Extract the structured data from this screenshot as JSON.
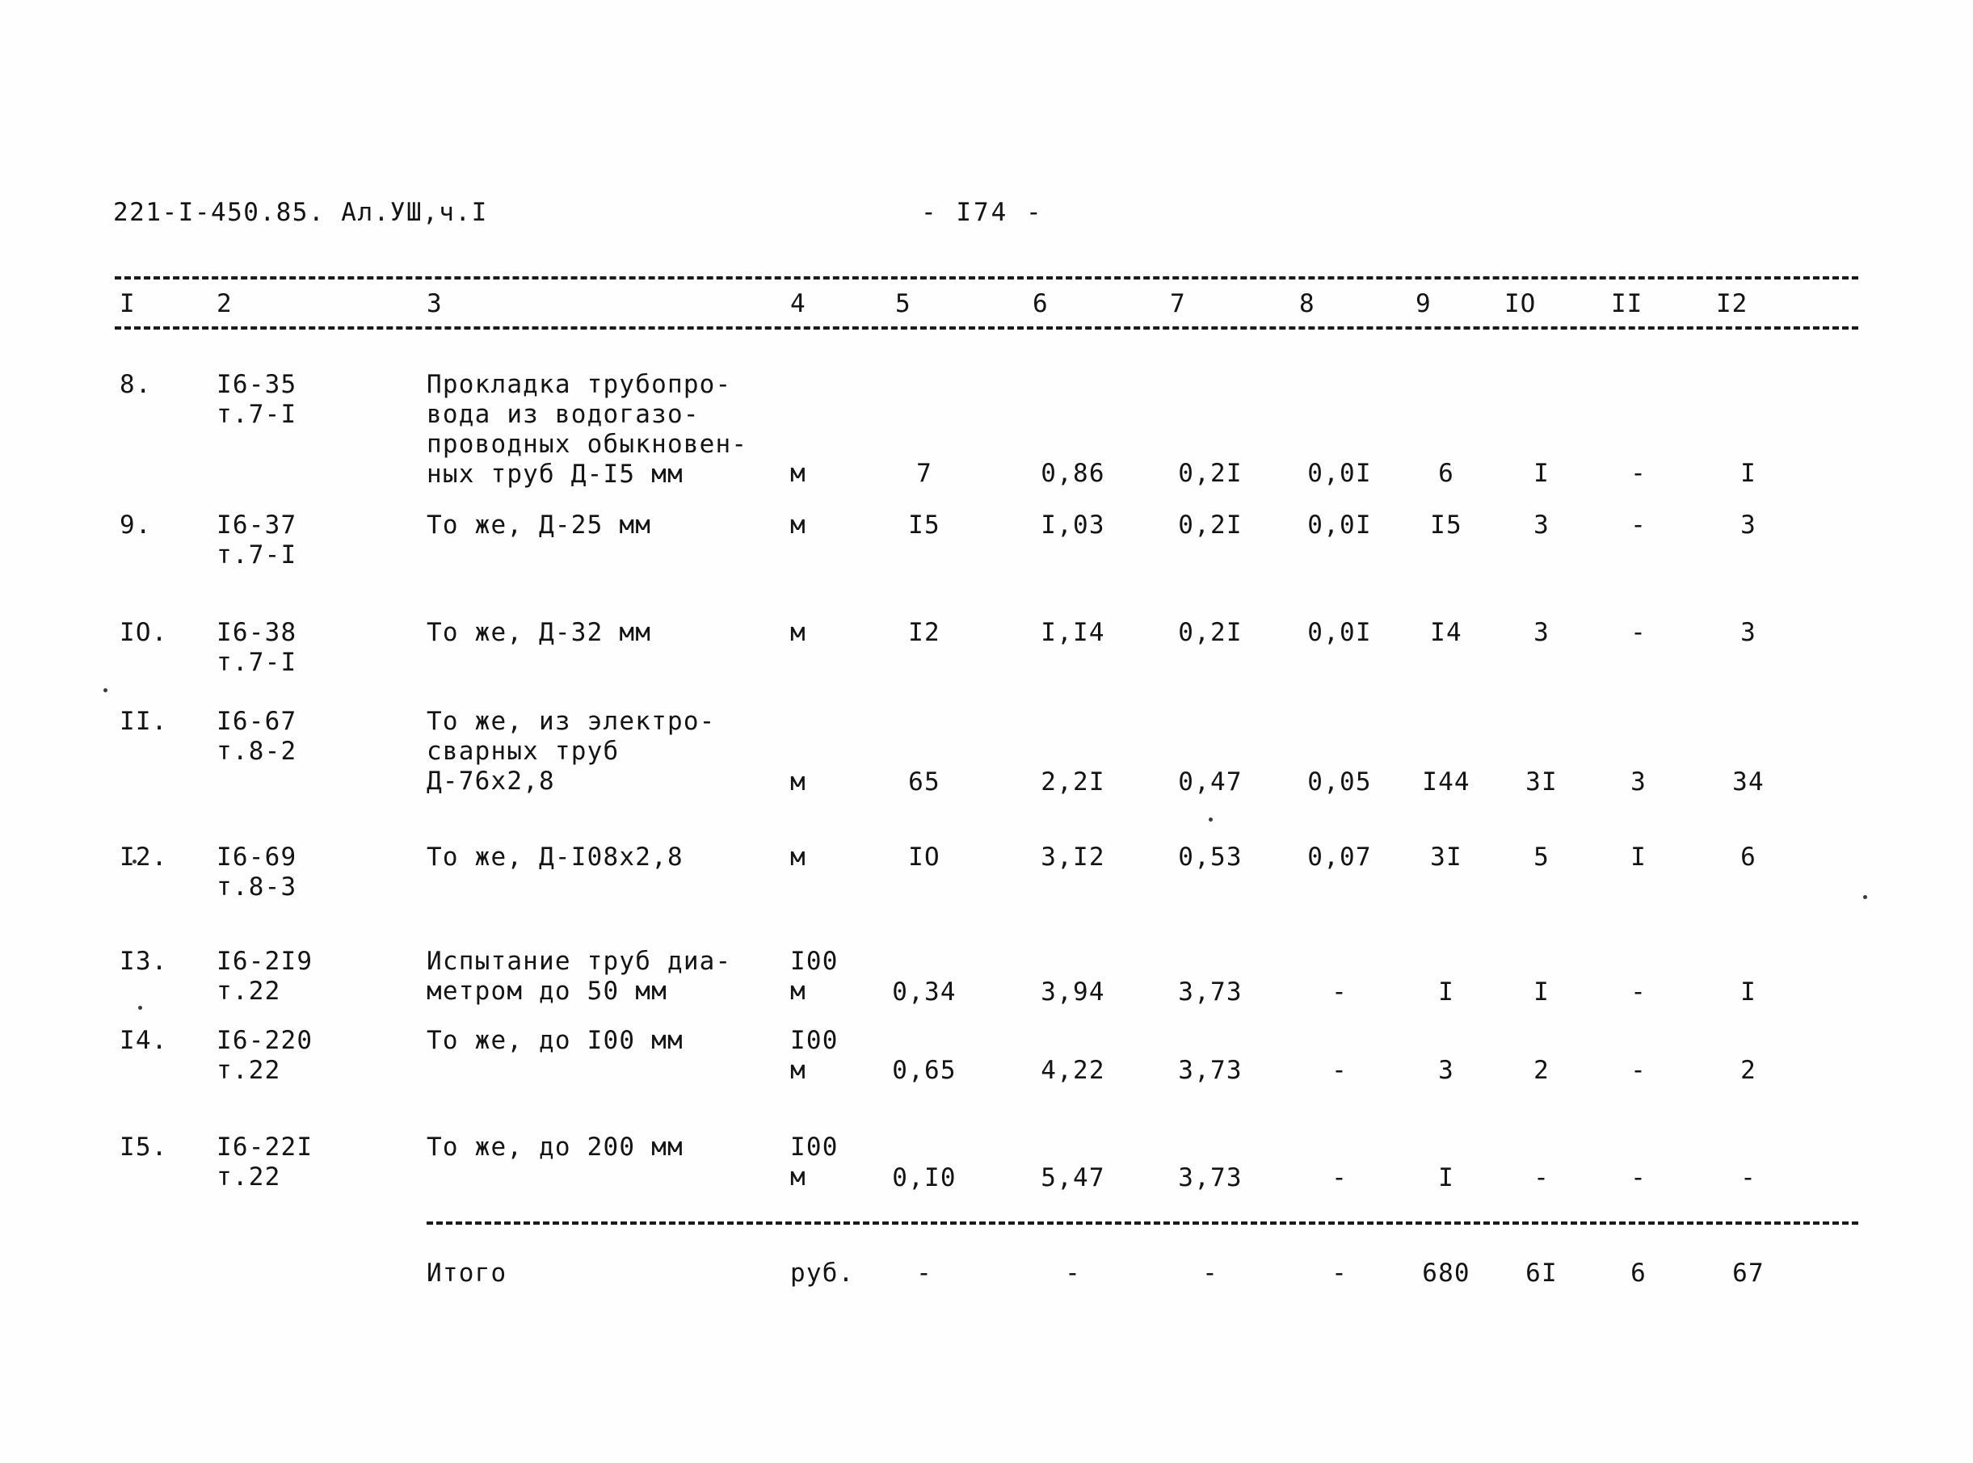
{
  "header": {
    "doc_code": "221-I-450.85. Ал.УШ,ч.I",
    "page_number": "-  I74  -"
  },
  "table": {
    "column_headers": [
      "I",
      "2",
      "3",
      "4",
      "5",
      "6",
      "7",
      "8",
      "9",
      "IO",
      "II",
      "I2"
    ],
    "rows": [
      {
        "num": "8.",
        "code": "I6-35\nт.7-I",
        "desc": "Прокладка трубопро-\nвода из водогазо-\nпроводных обыкновен-\nных труб Д-I5 мм",
        "unit": "м",
        "c5": "7",
        "c6": "0,86",
        "c7": "0,2I",
        "c8": "0,0I",
        "c9": "6",
        "c10": "I",
        "c11": "-",
        "c12": "I"
      },
      {
        "num": "9.",
        "code": "I6-37\nт.7-I",
        "desc": "То же, Д-25 мм",
        "unit": "м",
        "c5": "I5",
        "c6": "I,03",
        "c7": "0,2I",
        "c8": "0,0I",
        "c9": "I5",
        "c10": "3",
        "c11": "-",
        "c12": "3"
      },
      {
        "num": "IO.",
        "code": "I6-38\nт.7-I",
        "desc": "То же, Д-32 мм",
        "unit": "м",
        "c5": "I2",
        "c6": "I,I4",
        "c7": "0,2I",
        "c8": "0,0I",
        "c9": "I4",
        "c10": "3",
        "c11": "-",
        "c12": "3"
      },
      {
        "num": "II.",
        "code": "I6-67\nт.8-2",
        "desc": "То же, из электро-\nсварных труб\nД-76х2,8",
        "unit": "м",
        "c5": "65",
        "c6": "2,2I",
        "c7": "0,47",
        "c8": "0,05",
        "c9": "I44",
        "c10": "3I",
        "c11": "3",
        "c12": "34"
      },
      {
        "num": "I2.",
        "code": "I6-69\nт.8-3",
        "desc": "То же, Д-I08х2,8",
        "unit": "м",
        "c5": "IO",
        "c6": "3,I2",
        "c7": "0,53",
        "c8": "0,07",
        "c9": "3I",
        "c10": "5",
        "c11": "I",
        "c12": "6"
      },
      {
        "num": "I3.",
        "code": "I6-2I9\nт.22",
        "desc": "Испытание труб диа-\nметром до 50 мм",
        "unit": "I00\nм",
        "c5": "0,34",
        "c6": "3,94",
        "c7": "3,73",
        "c8": "-",
        "c9": "I",
        "c10": "I",
        "c11": "-",
        "c12": "I"
      },
      {
        "num": "I4.",
        "code": "I6-220\nт.22",
        "desc": "То же, до I00 мм",
        "unit": "I00\nм",
        "c5": "0,65",
        "c6": "4,22",
        "c7": "3,73",
        "c8": "-",
        "c9": "3",
        "c10": "2",
        "c11": "-",
        "c12": "2"
      },
      {
        "num": "I5.",
        "code": "I6-22I\nт.22",
        "desc": "То же, до 200 мм",
        "unit": "I00\nм",
        "c5": "0,I0",
        "c6": "5,47",
        "c7": "3,73",
        "c8": "-",
        "c9": "I",
        "c10": "-",
        "c11": "-",
        "c12": "-"
      }
    ],
    "total_row": {
      "label": "Итого",
      "unit": "руб.",
      "c5": "-",
      "c6": "-",
      "c7": "-",
      "c8": "-",
      "c9": "680",
      "c10": "6I",
      "c11": "6",
      "c12": "67"
    }
  }
}
